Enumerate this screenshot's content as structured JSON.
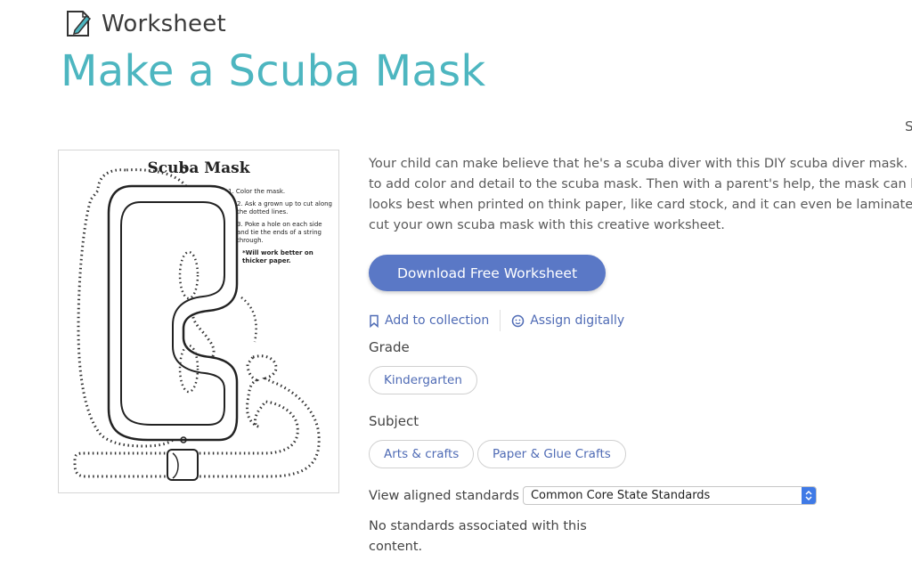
{
  "header": {
    "type_label": "Worksheet",
    "title": "Make a Scuba Mask",
    "edge_letter": "S"
  },
  "preview": {
    "title": "Scuba Mask",
    "step1": "1. Color the mask.",
    "step2": "2. Ask a grown up to cut along the dotted lines.",
    "step3": "3. Poke a hole on each side and tie the ends of a string through.",
    "note": "*Will work better on thicker paper."
  },
  "description": {
    "lines": [
      "Your child can make believe that he's a scuba diver with this DIY scuba diver mask. K",
      "to add color and detail to the scuba mask. Then with a parent's help, the mask can b",
      "looks best when printed on think paper, like card stock, and it can even be laminated",
      "cut your own scuba mask with this creative worksheet."
    ]
  },
  "download_button": "Download Free Worksheet",
  "actions": {
    "add_to_collection": "Add to collection",
    "assign_digitally": "Assign digitally"
  },
  "grade": {
    "label": "Grade",
    "chips": [
      "Kindergarten"
    ]
  },
  "subject": {
    "label": "Subject",
    "chips": [
      "Arts & crafts",
      "Paper & Glue Crafts"
    ]
  },
  "standards": {
    "label": "View aligned standards",
    "selected": "Common Core State Standards",
    "empty_message": "No standards associated with this content."
  },
  "colors": {
    "title": "#4db6c0",
    "button": "#5a78c6",
    "link": "#4f6bb5"
  }
}
